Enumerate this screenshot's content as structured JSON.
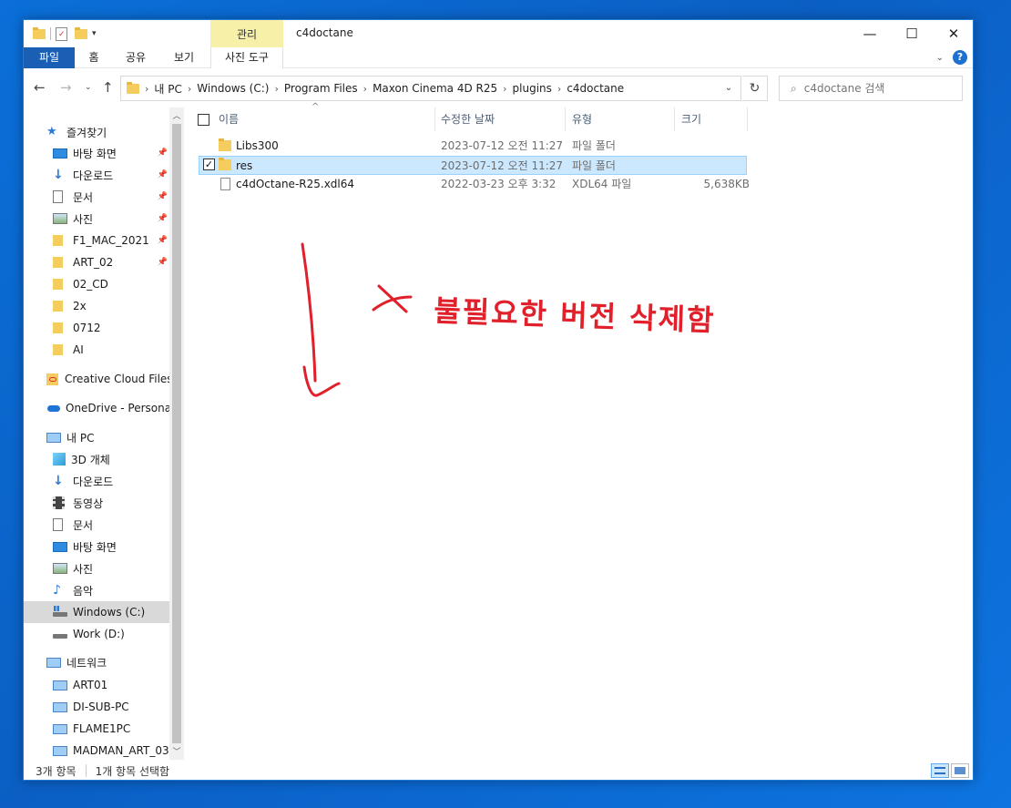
{
  "window": {
    "title": "c4doctane",
    "context_tab_group": "관리"
  },
  "ribbon": {
    "tabs": [
      "파일",
      "홈",
      "공유",
      "보기",
      "사진 도구"
    ]
  },
  "address": {
    "crumbs": [
      "내 PC",
      "Windows (C:)",
      "Program Files",
      "Maxon Cinema 4D R25",
      "plugins",
      "c4doctane"
    ]
  },
  "search": {
    "placeholder": "c4doctane 검색"
  },
  "nav": {
    "quick_access": "즐겨찾기",
    "quick_items": [
      "바탕 화면",
      "다운로드",
      "문서",
      "사진",
      "F1_MAC_2021",
      "ART_02",
      "02_CD",
      "2x",
      "0712",
      "AI"
    ],
    "creative_cloud": "Creative Cloud Files",
    "onedrive": "OneDrive - Personal",
    "this_pc": "내 PC",
    "pc_items": [
      "3D 개체",
      "다운로드",
      "동영상",
      "문서",
      "바탕 화면",
      "사진",
      "음악",
      "Windows (C:)",
      "Work (D:)"
    ],
    "network": "네트워크",
    "network_items": [
      "ART01",
      "DI-SUB-PC",
      "FLAME1PC",
      "MADMAN_ART_03"
    ]
  },
  "columns": {
    "name": "이름",
    "date": "수정한 날짜",
    "type": "유형",
    "size": "크기"
  },
  "files": [
    {
      "name": "Libs300",
      "date": "2023-07-12 오전 11:27",
      "type": "파일 폴더",
      "size": "",
      "kind": "folder",
      "selected": false
    },
    {
      "name": "res",
      "date": "2023-07-12 오전 11:27",
      "type": "파일 폴더",
      "size": "",
      "kind": "folder",
      "selected": true
    },
    {
      "name": "c4dOctane-R25.xdl64",
      "date": "2022-03-23 오후 3:32",
      "type": "XDL64 파일",
      "size": "5,638KB",
      "kind": "file",
      "selected": false
    }
  ],
  "annotation": {
    "text": "불필요한 버전 삭제함",
    "color": "#e0202a"
  },
  "status": {
    "item_count": "3개 항목",
    "selected_count": "1개 항목 선택함"
  }
}
